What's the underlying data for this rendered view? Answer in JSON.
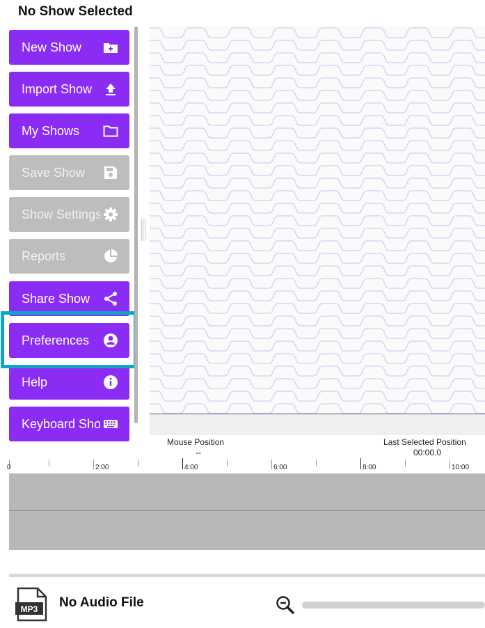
{
  "header": {
    "title": "No Show Selected"
  },
  "sidebar": {
    "items": [
      {
        "label": "New Show",
        "icon": "folder-plus-icon",
        "enabled": true
      },
      {
        "label": "Import Show",
        "icon": "upload-icon",
        "enabled": true
      },
      {
        "label": "My Shows",
        "icon": "folder-icon",
        "enabled": true
      },
      {
        "label": "Save Show",
        "icon": "save-icon",
        "enabled": false
      },
      {
        "label": "Show Settings",
        "icon": "gear-icon",
        "enabled": false
      },
      {
        "label": "Reports",
        "icon": "pie-chart-icon",
        "enabled": false
      },
      {
        "label": "Share Show",
        "icon": "share-icon",
        "enabled": true
      },
      {
        "label": "Preferences",
        "icon": "user-circle-icon",
        "enabled": true,
        "highlighted": true
      },
      {
        "label": "Help",
        "icon": "info-icon",
        "enabled": true
      },
      {
        "label": "Keyboard Shortcuts",
        "icon": "keyboard-icon",
        "enabled": true
      }
    ]
  },
  "positions": {
    "mouse_label": "Mouse Position",
    "mouse_value": "--",
    "last_label": "Last Selected Position",
    "last_value": "00:00.0"
  },
  "timeline": {
    "ticks": [
      "0",
      "2:00",
      "4:00",
      "6:00",
      "8:00",
      "10:00"
    ]
  },
  "audio": {
    "file_badge": "MP3",
    "label": "No Audio File",
    "zoom_icon": "zoom-out-icon"
  },
  "colors": {
    "accent": "#8b2cf5",
    "disabled": "#bdbdbd",
    "highlight": "#0ea5c9",
    "grid_line": "#d9ccf2"
  }
}
